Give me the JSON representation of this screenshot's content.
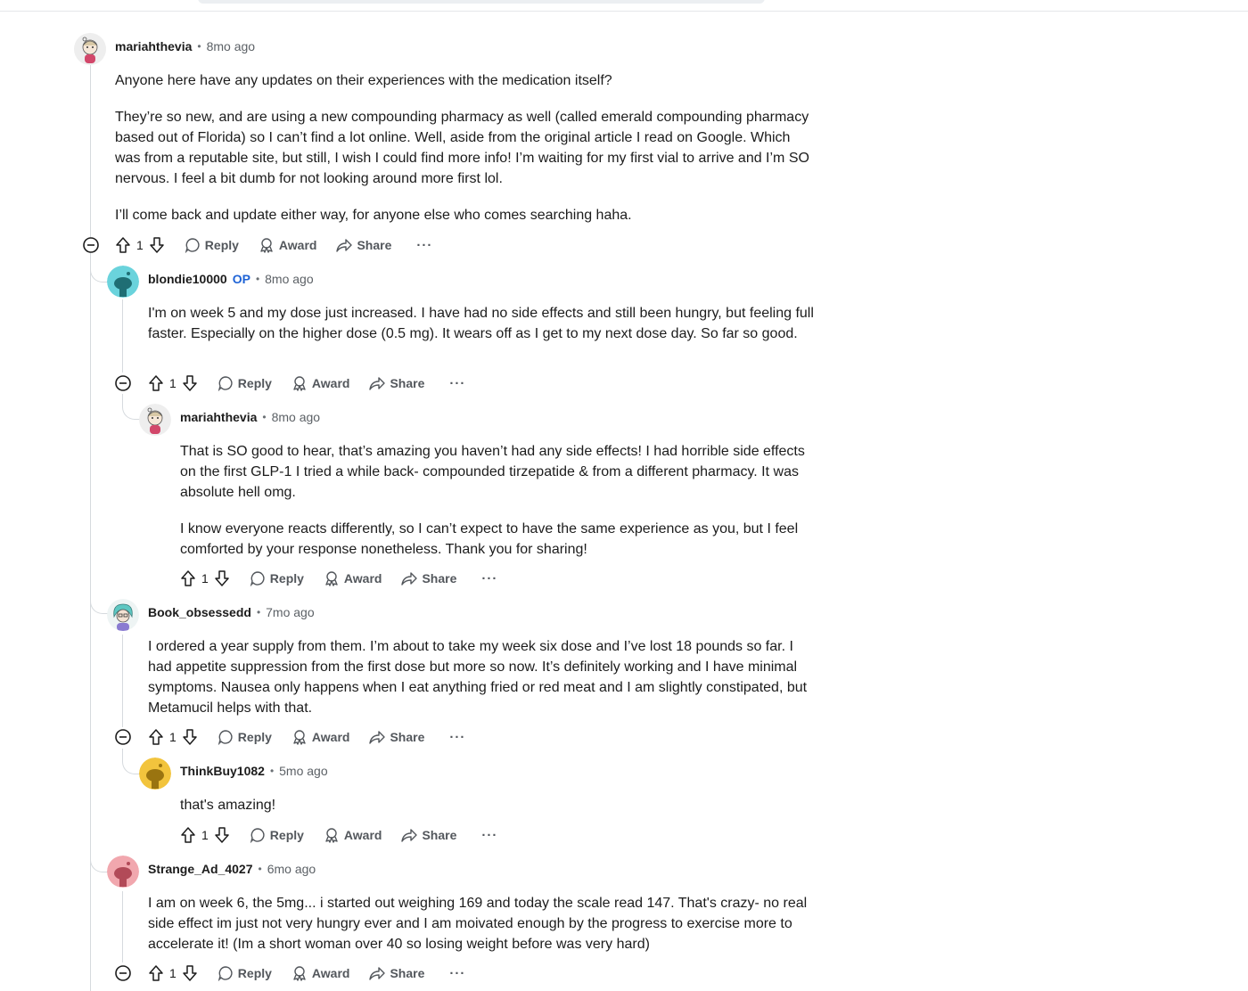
{
  "actions": {
    "reply_label": "Reply",
    "award_label": "Award",
    "share_label": "Share",
    "more_label": "···"
  },
  "colors": {
    "op_badge": "#1e63d6",
    "thread_line": "#d6dade",
    "avatar_blondie": "#6ad3dc",
    "avatar_thinkbuy": "#f2c43d",
    "avatar_strange": "#f1a7ae"
  },
  "comments": [
    {
      "username": "mariahthevia",
      "time": "8mo ago",
      "paragraphs": [
        "Anyone here have any updates on their experiences with the medication itself?",
        "They’re so new, and are using a new compounding pharmacy as well (called emerald compounding pharmacy based out of Florida) so I can’t find a lot online. Well, aside from the original article I read on Google. Which was from a reputable site, but still, I wish I could find more info! I’m waiting for my first vial to arrive and I’m SO nervous. I feel a bit dumb for not looking around more first lol.",
        "I’ll come back and update either way, for anyone else who comes searching haha."
      ],
      "votes": "1"
    },
    {
      "username": "blondie10000",
      "op_badge": "OP",
      "time": "8mo ago",
      "paragraphs": [
        "I'm on week 5 and my dose just increased. I have had no side effects and still been hungry, but feeling full faster. Especially on the higher dose (0.5 mg). It wears off as I get to my next dose day. So far so good."
      ],
      "votes": "1"
    },
    {
      "username": "mariahthevia",
      "time": "8mo ago",
      "paragraphs": [
        "That is SO good to hear, that’s amazing you haven’t had any side effects! I had horrible side effects on the first GLP-1 I tried a while back- compounded tirzepatide & from a different pharmacy. It was absolute hell omg.",
        "I know everyone reacts differently, so I can’t expect to have the same experience as you, but I feel comforted by your response nonetheless. Thank you for sharing!"
      ],
      "votes": "1"
    },
    {
      "username": "Book_obsessedd",
      "time": "7mo ago",
      "paragraphs": [
        "I ordered a year supply from them. I’m about to take my week six dose and I’ve lost 18 pounds so far. I had appetite suppression from the first dose but more so now. It’s definitely working and I have minimal symptoms. Nausea only happens when I eat anything fried or red meat and I am slightly constipated, but Metamucil helps with that."
      ],
      "votes": "1"
    },
    {
      "username": "ThinkBuy1082",
      "time": "5mo ago",
      "paragraphs": [
        "that's amazing!"
      ],
      "votes": "1"
    },
    {
      "username": "Strange_Ad_4027",
      "time": "6mo ago",
      "paragraphs": [
        "I am on week 6, the 5mg... i started out weighing 169 and today the scale read 147. That's crazy- no real side effect im just not very hungry ever and I am moivated enough by the progress to exercise more to accelerate it! (Im a short woman over 40 so losing weight before was very hard)"
      ],
      "votes": "1"
    }
  ]
}
